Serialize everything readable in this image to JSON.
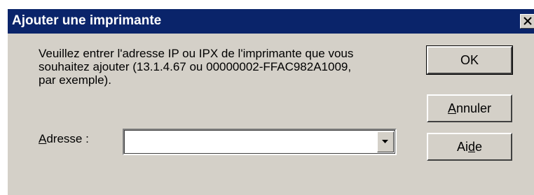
{
  "window": {
    "title": "Ajouter une imprimante",
    "close_symbol": "×"
  },
  "message": {
    "lines": [
      "Veuillez entrer l'adresse IP ou IPX de l'imprimante que vous",
      "souhaitez ajouter (13.1.4.67 ou 00000002-FFAC982A1009,",
      "par exemple)."
    ]
  },
  "address": {
    "label_accel": "A",
    "label_rest": "dresse :",
    "value": "",
    "placeholder": ""
  },
  "buttons": {
    "ok": "OK",
    "cancel_accel": "A",
    "cancel_rest": "nnuler",
    "help_pre": "Ai",
    "help_accel": "d",
    "help_post": "e"
  },
  "icons": {
    "close": "close-icon",
    "dropdown": "chevron-down-icon"
  },
  "colors": {
    "titlebar": "#0a246a",
    "face": "#d4d0c8"
  }
}
